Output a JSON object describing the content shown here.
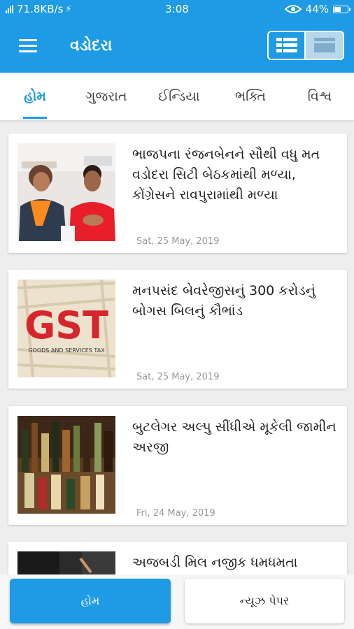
{
  "status_bar": {
    "network_speed": "71.8KB/s",
    "time": "3:08",
    "battery": "44%",
    "battery_level": 0.44
  },
  "app_bar": {
    "menu_icon": "hamburger-menu-icon",
    "title": "વડોદરા",
    "view_toggle": [
      "grid-view-icon",
      "card-view-icon"
    ]
  },
  "tabs": [
    {
      "label": "હોમ",
      "active": true
    },
    {
      "label": "ગુજરાત",
      "active": false
    },
    {
      "label": "ઈન્ડિયા",
      "active": false
    },
    {
      "label": "ભક્તિ",
      "active": false
    },
    {
      "label": "વિશ્વ",
      "active": false
    }
  ],
  "articles": [
    {
      "title": "ભાજપના રંજનબેનને સૌથી વધુ મત વડોદરા સિટી બેઠકમાંથી મળ્યા, કોંગ્રેસને રાવપુરામાંથી મળ્યા",
      "date": "Sat, 25 May, 2019"
    },
    {
      "title": "મનપસંદ બેવરેજીસનું 300 કરોડનું બોગસ બિલનું કૌભાંડ",
      "date": "Sat, 25 May, 2019",
      "image_text": {
        "main": "GST",
        "sub": "GOODS AND SERVICES TAX"
      }
    },
    {
      "title": "બુટલેગર અલ્પુ સીંધીએ મૂકેલી જામીન અરજી",
      "date": "Fri, 24 May, 2019"
    },
    {
      "title": "અજબડી મિલ નજીક ધમધમતા",
      "date": ""
    }
  ],
  "bottom_nav": {
    "home_label": "હોમ",
    "newspaper_label": "ન્યૂઝ પેપર"
  },
  "colors": {
    "primary": "#1e9be4",
    "background": "#eeeeee",
    "card": "#ffffff",
    "date_text": "#999999"
  }
}
